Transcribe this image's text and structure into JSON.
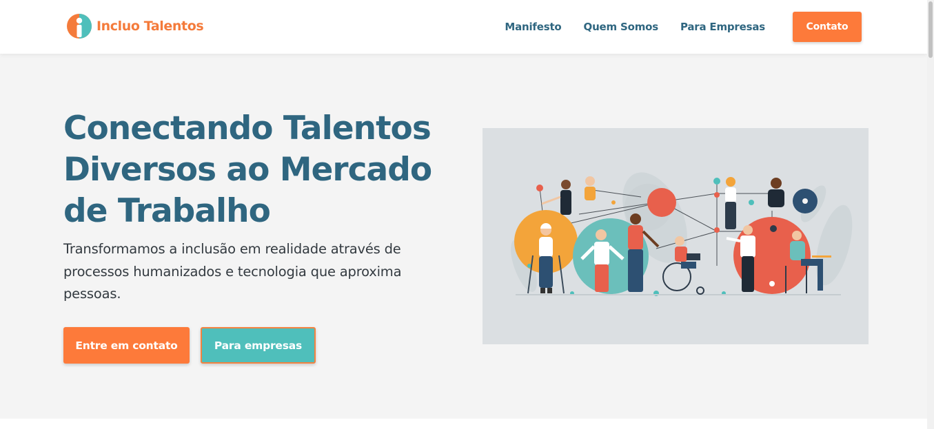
{
  "header": {
    "logo_text": "Incluo Talentos",
    "nav": [
      {
        "label": "Manifesto"
      },
      {
        "label": "Quem Somos"
      },
      {
        "label": "Para Empresas"
      }
    ],
    "cta_label": "Contato"
  },
  "hero": {
    "title": "Conectando Talentos Diversos ao Mercado de Trabalho",
    "subtitle": "Transformamos a inclusão em realidade através de processos humanizados e tecnologia que aproxima pessoas.",
    "primary_button": "Entre em contato",
    "secondary_button": "Para empresas"
  },
  "colors": {
    "brand_orange": "#fd7a3a",
    "brand_teal": "#4fbfbb",
    "heading_blue": "#2f6680",
    "hero_bg": "#f4f4f4"
  },
  "icons": {
    "logo": "incluo-logo-icon",
    "illustration": "diverse-people-network-illustration"
  }
}
